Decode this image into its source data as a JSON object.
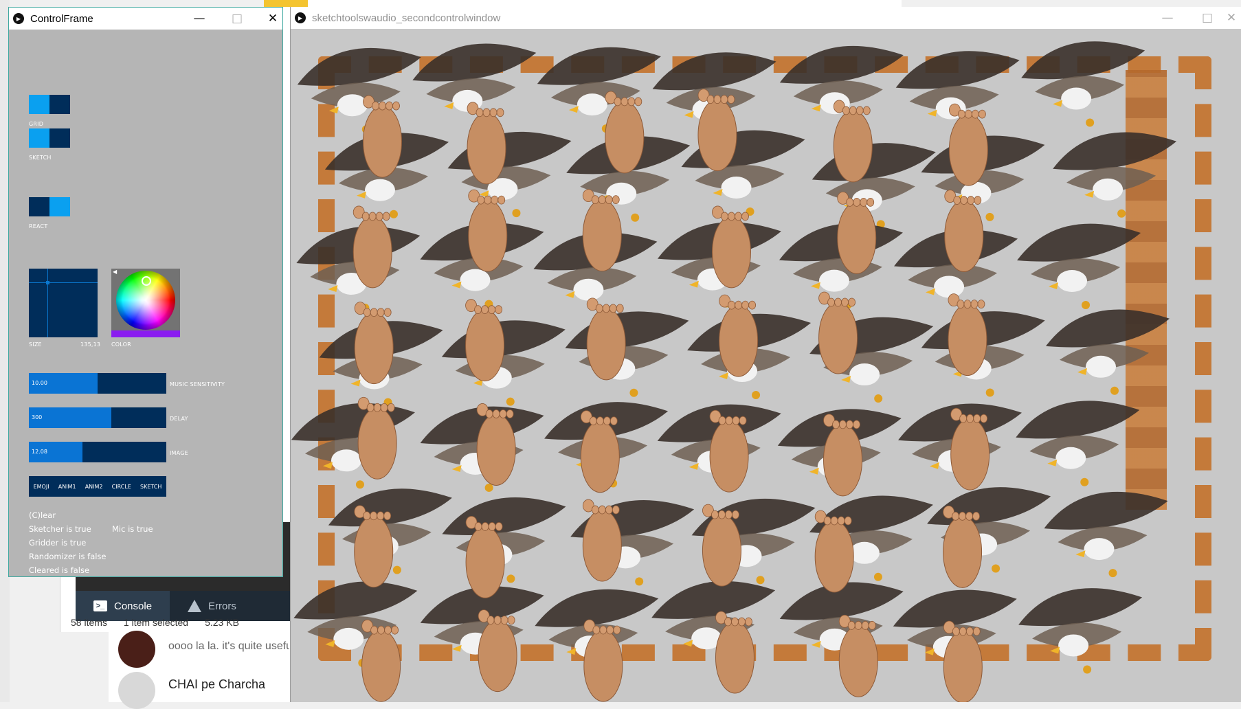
{
  "background": {
    "ide_tabs": [
      {
        "label": "Console",
        "icon": "terminal-icon"
      },
      {
        "label": "Errors",
        "icon": "warning-icon"
      }
    ],
    "explorer_status": {
      "items": "58 items",
      "selected": "1 item selected",
      "size": "5.23 KB"
    },
    "chat": {
      "message": "oooo la la. it's quite useful",
      "name": "CHAI pe Charcha"
    }
  },
  "control_frame": {
    "title": "ControlFrame",
    "toggles": [
      {
        "label": "GRID",
        "state": "on"
      },
      {
        "label": "SKETCH",
        "state": "on"
      },
      {
        "label": "REACT",
        "state": "off"
      }
    ],
    "size_pad": {
      "label": "SIZE",
      "value": "135,13"
    },
    "color_picker": {
      "label": "COLOR",
      "selected_color": "#8a1cf0"
    },
    "sliders": [
      {
        "label": "MUSIC SENSITIVITY",
        "value": "10.00",
        "fill": 0.5
      },
      {
        "label": "DELAY",
        "value": "300",
        "fill": 0.6
      },
      {
        "label": "IMAGE",
        "value": "12.08",
        "fill": 0.39
      }
    ],
    "modes": [
      "EMOJI",
      "ANIM1",
      "ANIM2",
      "CIRCLE",
      "SKETCH"
    ],
    "status": {
      "clear": "(C)lear",
      "sketcher": "Sketcher is true",
      "mic": "Mic is true",
      "gridder": "Gridder is true",
      "randomizer": "Randomizer is false",
      "cleared": "Cleared is false"
    }
  },
  "sketch_window": {
    "title": "sketchtoolswaudio_secondcontrolwindow"
  },
  "colors": {
    "toggle_bright": "#0aa0f0",
    "toggle_dark": "#002d5a",
    "panel_bg": "#b5b5b5"
  }
}
